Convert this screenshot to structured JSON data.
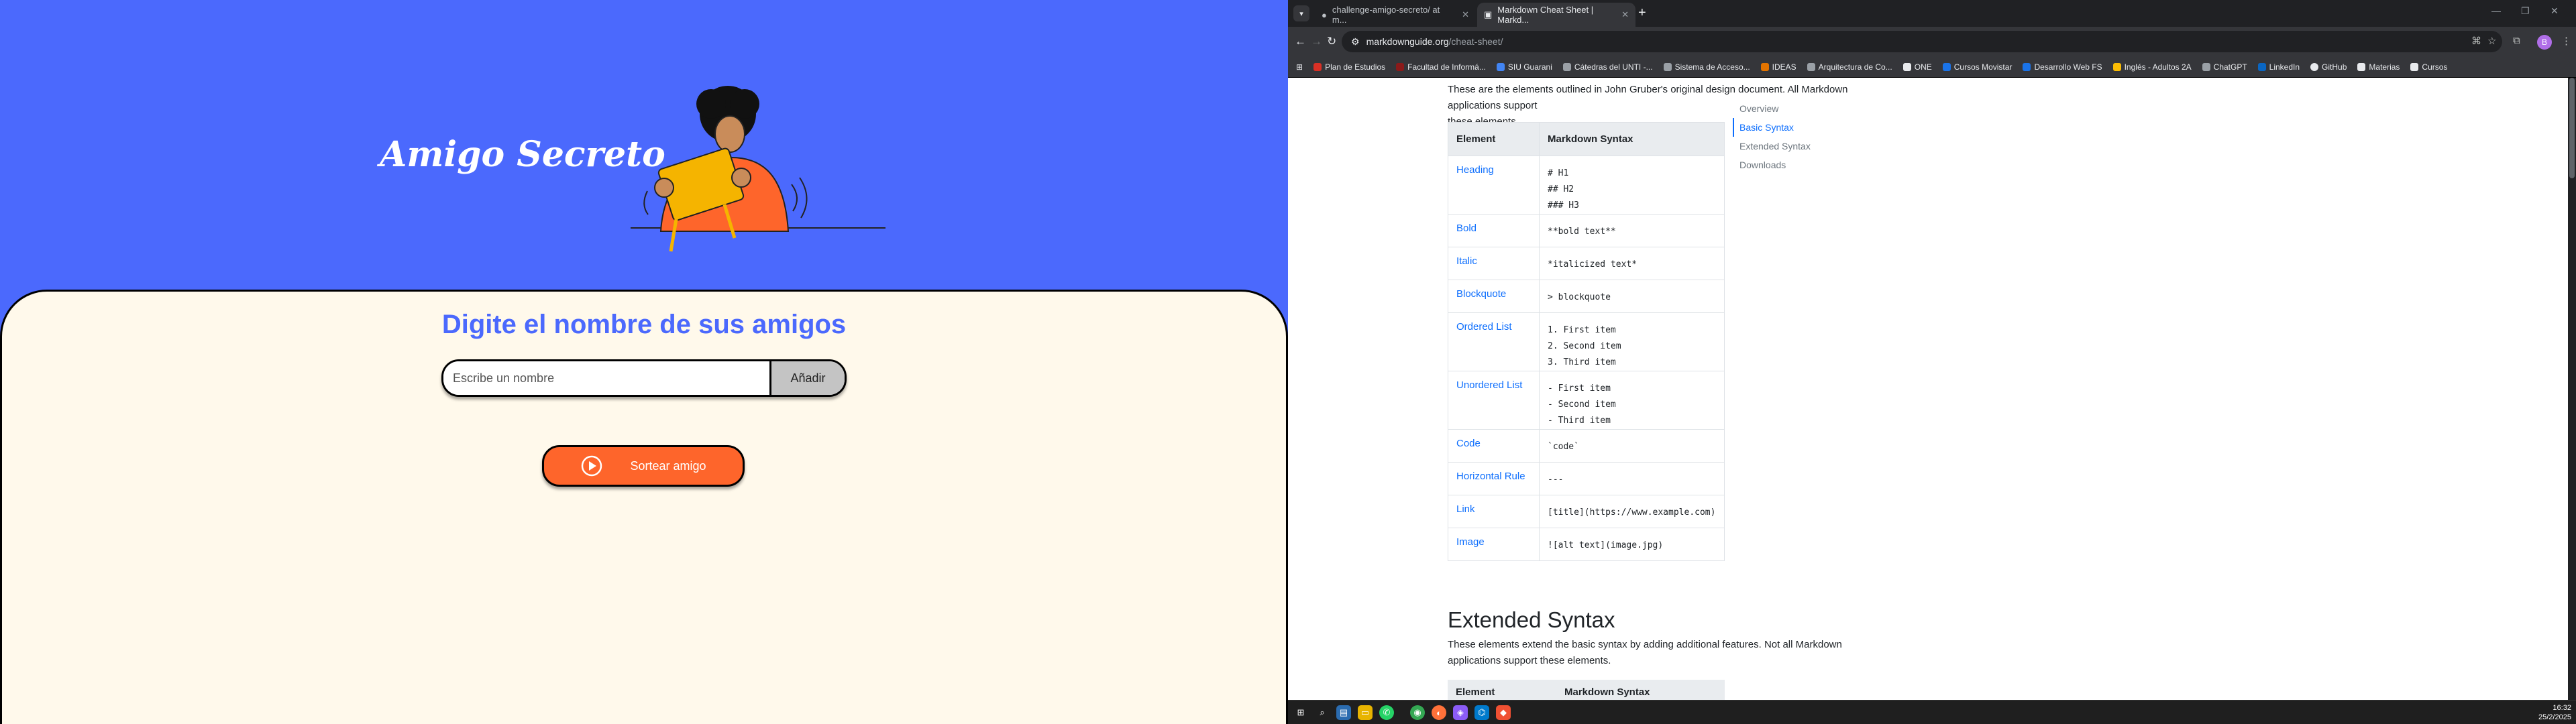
{
  "app": {
    "title": "Amigo Secreto",
    "subtitle": "Digite el nombre de sus amigos",
    "input_placeholder": "Escribe un nombre",
    "add_button": "Añadir",
    "draw_button": "Sortear amigo"
  },
  "browser": {
    "tabs": [
      {
        "label": "challenge-amigo-secreto/ at m..."
      },
      {
        "label": "Markdown Cheat Sheet | Markd..."
      }
    ],
    "url_host": "markdownguide.org",
    "url_path": "/cheat-sheet/",
    "profile_initial": "B",
    "bookmarks": [
      {
        "label": "Plan de Estudios",
        "icon": "bookmark-icon",
        "color": "#d93025"
      },
      {
        "label": "Facultad de Informá...",
        "icon": "faculty-icon",
        "color": "#8b1a1a"
      },
      {
        "label": "SIU Guarani",
        "icon": "siu-icon",
        "color": "#4285f4"
      },
      {
        "label": "Cátedras del UNTI -...",
        "icon": "globe-icon",
        "color": "#9aa0a6"
      },
      {
        "label": "Sistema de Acceso...",
        "icon": "doc-icon",
        "color": "#9aa0a6"
      },
      {
        "label": "IDEAS",
        "icon": "ideas-icon",
        "color": "#e37400"
      },
      {
        "label": "Arquitectura de Co...",
        "icon": "globe-icon",
        "color": "#9aa0a6"
      },
      {
        "label": "ONE",
        "icon": "folder-icon",
        "color": "#e8eaed"
      },
      {
        "label": "Cursos Movistar",
        "icon": "movistar-icon",
        "color": "#1a73e8"
      },
      {
        "label": "Desarrollo Web FS",
        "icon": "web-icon",
        "color": "#1a73e8"
      },
      {
        "label": "Inglés - Adultos 2A",
        "icon": "english-icon",
        "color": "#fbbc04"
      },
      {
        "label": "ChatGPT",
        "icon": "chatgpt-icon",
        "color": "#9aa0a6"
      },
      {
        "label": "LinkedIn",
        "icon": "linkedin-icon",
        "color": "#0a66c2"
      },
      {
        "label": "GitHub",
        "icon": "github-icon",
        "color": "#e8eaed"
      },
      {
        "label": "Materias",
        "icon": "folder-icon",
        "color": "#e8eaed"
      },
      {
        "label": "Cursos",
        "icon": "folder-icon",
        "color": "#e8eaed"
      }
    ]
  },
  "doc": {
    "intro_line1": "These are the elements outlined in John Gruber's original design document. All Markdown applications support",
    "intro_line2": "these elements.",
    "table_headers": [
      "Element",
      "Markdown Syntax"
    ],
    "rows": [
      {
        "element": "Heading",
        "syntax": "# H1\n## H2\n### H3"
      },
      {
        "element": "Bold",
        "syntax": "**bold text**"
      },
      {
        "element": "Italic",
        "syntax": "*italicized text*"
      },
      {
        "element": "Blockquote",
        "syntax": "> blockquote"
      },
      {
        "element": "Ordered List",
        "syntax": "1. First item\n2. Second item\n3. Third item"
      },
      {
        "element": "Unordered List",
        "syntax": "- First item\n- Second item\n- Third item"
      },
      {
        "element": "Code",
        "syntax": "`code`"
      },
      {
        "element": "Horizontal Rule",
        "syntax": "---"
      },
      {
        "element": "Link",
        "syntax": "[title](https://www.example.com)"
      },
      {
        "element": "Image",
        "syntax": "![alt text](image.jpg)"
      }
    ],
    "extended_title": "Extended Syntax",
    "extended_p": "These elements extend the basic syntax by adding additional features. Not all Markdown applications support these elements.",
    "ext_headers": [
      "Element",
      "Markdown Syntax"
    ],
    "toc": [
      "Overview",
      "Basic Syntax",
      "Extended Syntax",
      "Downloads"
    ],
    "toc_active": "Basic Syntax"
  },
  "taskbar": {
    "time": "16:32",
    "date": "25/2/2025",
    "icons": [
      "windows-icon",
      "search-icon",
      "task-view-icon",
      "file-explorer-icon",
      "whatsapp-icon",
      "chrome-icon",
      "firefox-icon",
      "app-icon",
      "vscode-icon",
      "git-icon"
    ]
  },
  "colors": {
    "app_blue": "#4b69fd",
    "app_cream": "#fff9eb",
    "app_orange": "#fe652b",
    "link_blue": "#0d6efd"
  }
}
